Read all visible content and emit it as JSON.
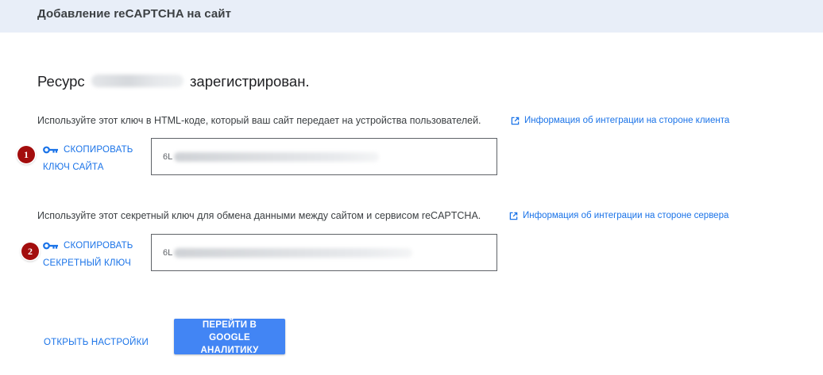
{
  "header": {
    "title": "Добавление reCAPTCHA на сайт"
  },
  "heading": {
    "prefix": "Ресурс",
    "domain": "max-demo.ru",
    "suffix": "зарегистрирован."
  },
  "site_key": {
    "description": "Используйте этот ключ в HTML-коде, который ваш сайт передает на устройства пользователей.",
    "info_link": "Информация об интеграции на стороне клиента",
    "badge": "1",
    "copy_line1": "СКОПИРОВАТЬ",
    "copy_line2": "КЛЮЧ САЙТА",
    "value_prefix": "6L"
  },
  "secret_key": {
    "description": "Используйте этот секретный ключ для обмена данными между сайтом и сервисом reCAPTCHA.",
    "info_link": "Информация об интеграции на стороне сервера",
    "badge": "2",
    "copy_line1": "СКОПИРОВАТЬ",
    "copy_line2": "СЕКРЕТНЫЙ КЛЮЧ",
    "value_prefix": "6L"
  },
  "footer": {
    "settings_link": "ОТКРЫТЬ НАСТРОЙКИ",
    "analytics_button": "ПЕРЕЙТИ В GOOGLE АНАЛИТИКУ"
  },
  "icons": {
    "key": "key-icon",
    "external_link": "open-in-new-icon"
  },
  "colors": {
    "accent": "#1a73e8",
    "button": "#4285f4",
    "header_bg": "#e8eef8",
    "badge": "#a30d0d"
  }
}
